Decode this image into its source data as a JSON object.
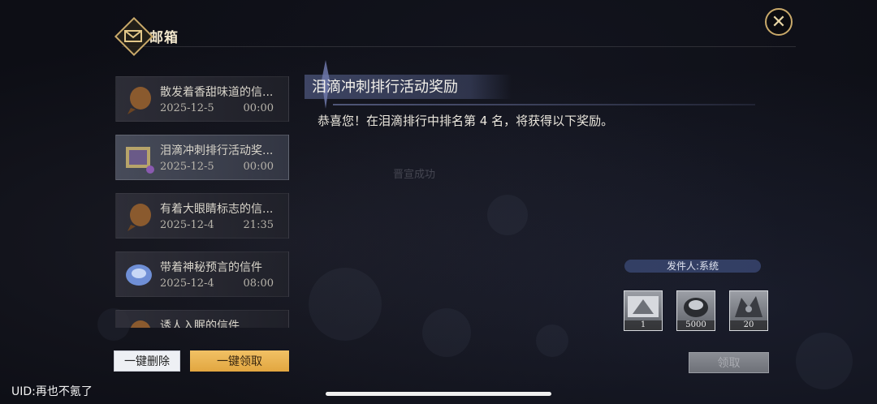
{
  "header": {
    "title": "邮箱",
    "close_icon": "close-icon"
  },
  "mails": [
    {
      "title": "散发着香甜味道的信...",
      "date": "2025-12-5",
      "time": "00:00",
      "icon": "shell-icon",
      "selected": false
    },
    {
      "title": "泪滴冲刺排行活动奖...",
      "date": "2025-12-5",
      "time": "00:00",
      "icon": "gift-icon",
      "selected": true
    },
    {
      "title": "有着大眼睛标志的信...",
      "date": "2025-12-4",
      "time": "21:35",
      "icon": "shell-icon",
      "selected": false
    },
    {
      "title": "带着神秘预言的信件",
      "date": "2025-12-4",
      "time": "08:00",
      "icon": "crystal-icon",
      "selected": false
    },
    {
      "title": "诱人入眠的信件",
      "date": "",
      "time": "",
      "icon": "shell-icon",
      "selected": false
    }
  ],
  "actions": {
    "delete_all": "一键删除",
    "collect_all": "一键领取",
    "claim": "领取"
  },
  "detail": {
    "title": "泪滴冲刺排行活动奖励",
    "body": "恭喜您！在泪滴排行中排名第 4 名，将获得以下奖励。",
    "faded_text": "晋宣成功",
    "sender": "发件人:系统",
    "rewards": [
      {
        "icon": "ticket-icon",
        "count": "1"
      },
      {
        "icon": "coin-icon",
        "count": "5000"
      },
      {
        "icon": "creature-icon",
        "count": "20"
      }
    ]
  },
  "footer": {
    "uid": "UID:再也不氪了"
  }
}
